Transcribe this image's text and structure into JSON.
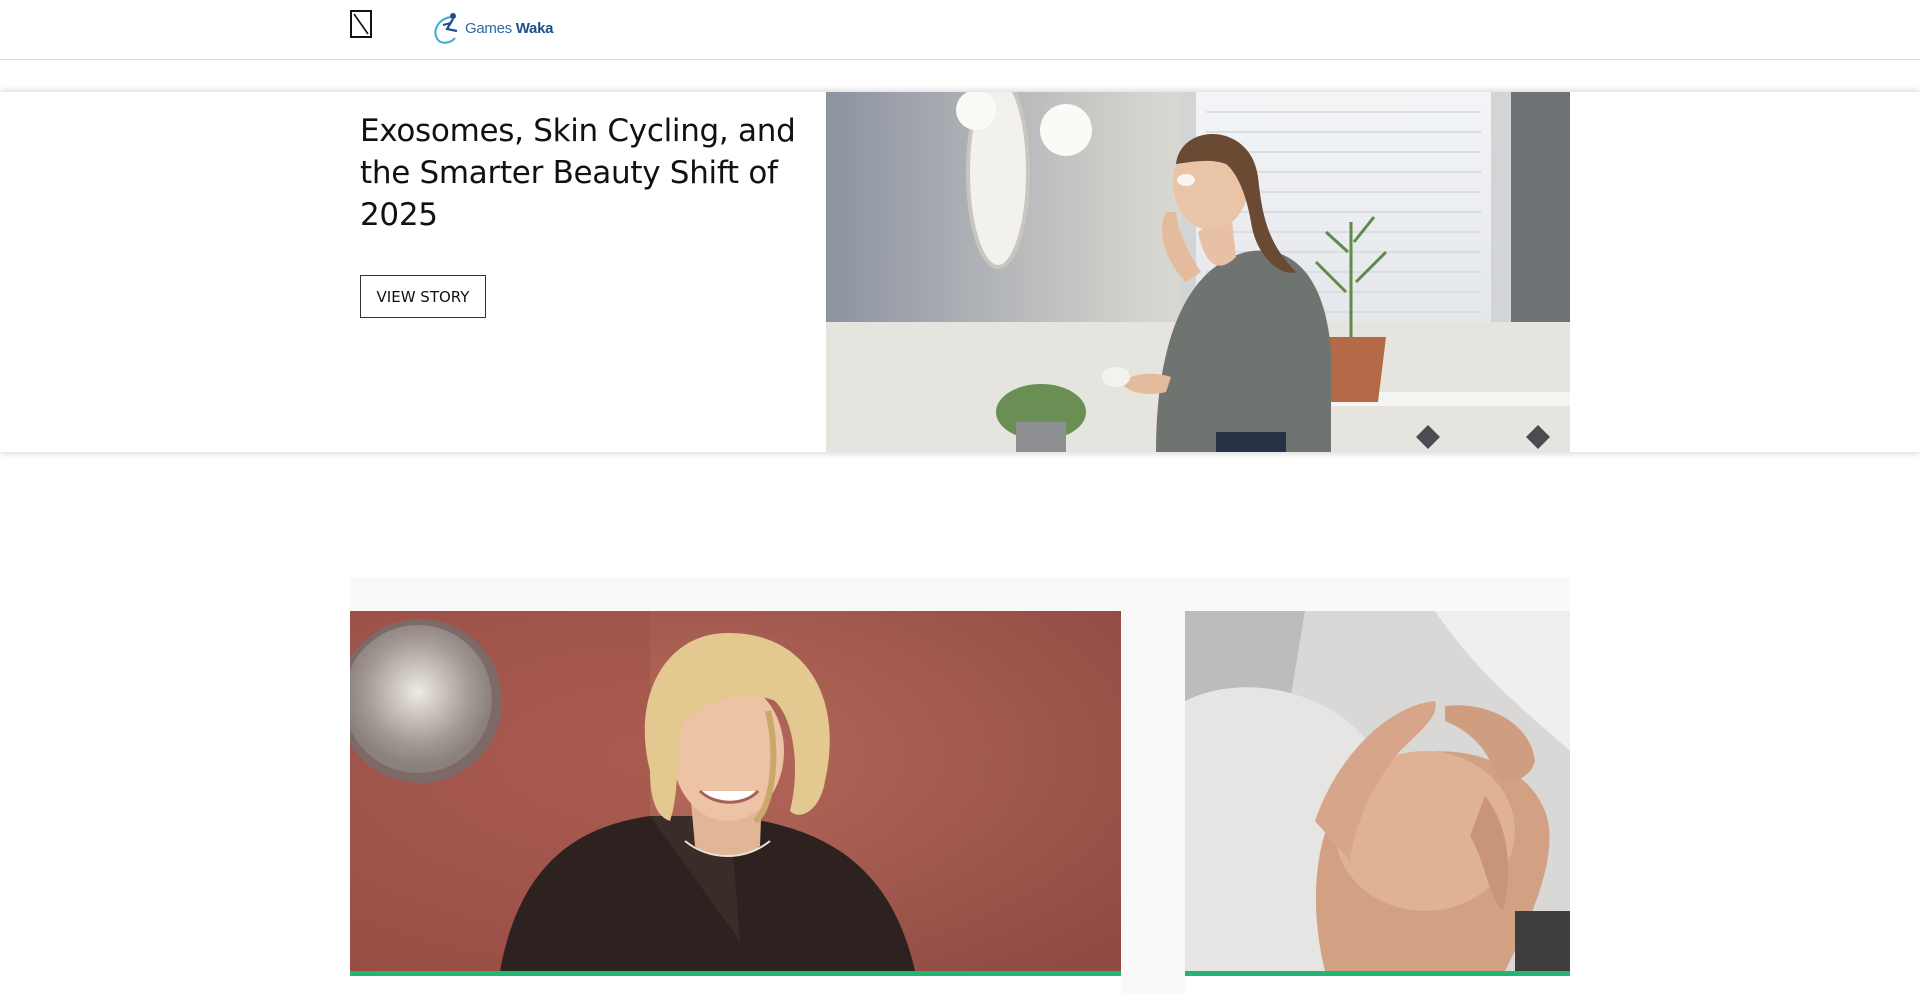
{
  "header": {
    "logo_text_regular": "Games",
    "logo_text_bold": "Waka"
  },
  "hero": {
    "title": "Exosomes, Skin Cycling, and the Smarter Beauty Shift of 2025",
    "button_label": "VIEW STORY"
  },
  "colors": {
    "accent_bar": "#22b573",
    "logo_blue": "#2f6aa8"
  }
}
